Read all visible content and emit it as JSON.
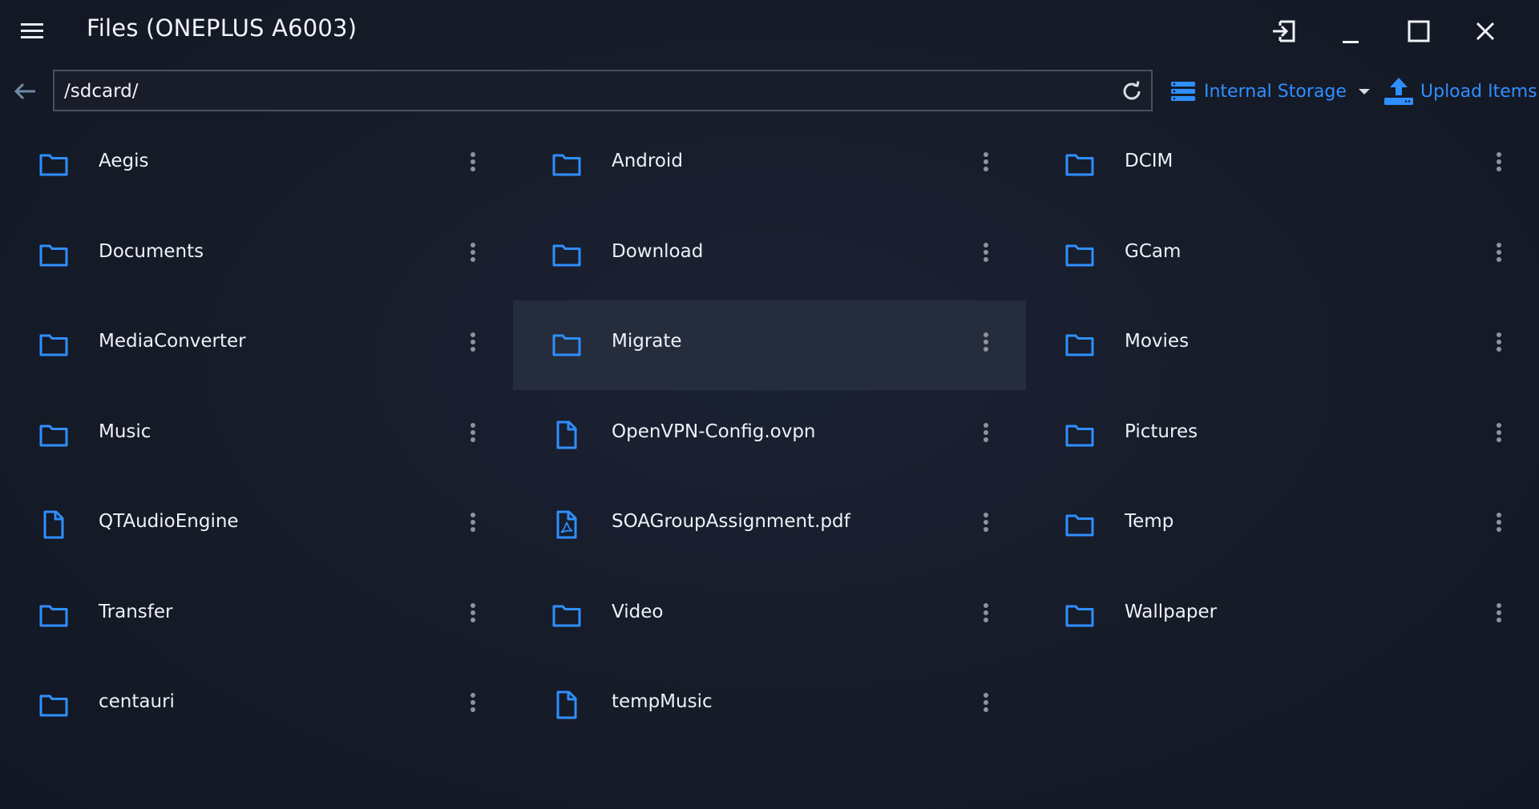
{
  "window": {
    "title": "Files (ONEPLUS A6003)",
    "menu_icon": "hamburger-menu-icon",
    "controls": [
      "exit-icon",
      "minimize-icon",
      "maximize-icon",
      "close-icon"
    ]
  },
  "toolbar": {
    "back_icon": "arrow-left-icon",
    "path_value": "/sdcard/",
    "refresh_icon": "refresh-icon",
    "storage_label": "Internal Storage",
    "storage_icon": "storage-icon",
    "upload_label": "Upload Items",
    "upload_icon": "upload-icon"
  },
  "colors": {
    "accent": "#2f8fff",
    "background": "#161b28",
    "selected_row": "#252c3c",
    "text": "#eef1f6"
  },
  "files": [
    {
      "name": "Aegis",
      "type": "folder"
    },
    {
      "name": "Android",
      "type": "folder"
    },
    {
      "name": "DCIM",
      "type": "folder"
    },
    {
      "name": "Documents",
      "type": "folder"
    },
    {
      "name": "Download",
      "type": "folder"
    },
    {
      "name": "GCam",
      "type": "folder"
    },
    {
      "name": "MediaConverter",
      "type": "folder"
    },
    {
      "name": "Migrate",
      "type": "folder",
      "selected": true
    },
    {
      "name": "Movies",
      "type": "folder"
    },
    {
      "name": "Music",
      "type": "folder"
    },
    {
      "name": "OpenVPN-Config.ovpn",
      "type": "file"
    },
    {
      "name": "Pictures",
      "type": "folder"
    },
    {
      "name": "QTAudioEngine",
      "type": "file"
    },
    {
      "name": "SOAGroupAssignment.pdf",
      "type": "pdf"
    },
    {
      "name": "Temp",
      "type": "folder"
    },
    {
      "name": "Transfer",
      "type": "folder"
    },
    {
      "name": "Video",
      "type": "folder"
    },
    {
      "name": "Wallpaper",
      "type": "folder"
    },
    {
      "name": "centauri",
      "type": "folder"
    },
    {
      "name": "tempMusic",
      "type": "file"
    }
  ]
}
